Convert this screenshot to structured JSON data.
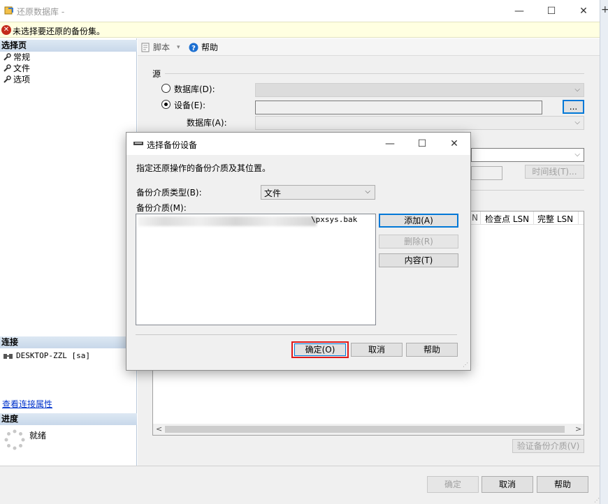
{
  "window": {
    "title": "还原数据库 -",
    "minimize": "—",
    "maximize": "☐",
    "close": "✕"
  },
  "error": {
    "icon": "error-icon",
    "text": "未选择要还原的备份集。"
  },
  "left": {
    "select_page": "选择页",
    "pages": [
      "常规",
      "文件",
      "选项"
    ],
    "connection_header": "连接",
    "server": "DESKTOP-ZZL [sa]",
    "view_props": "查看连接属性",
    "progress_header": "进度",
    "status": "就绪"
  },
  "toolbar": {
    "script": "脚本",
    "help": "帮助"
  },
  "source": {
    "group": "源",
    "database_label": "数据库(D):",
    "device_label": "设备(E):",
    "browse": "...",
    "db_label": "数据库(A):"
  },
  "main": {
    "timeline": "时间线(T)...",
    "grid_headers": [
      "检查点 LSN",
      "完整 LSN"
    ],
    "verify": "验证备份介质(V)",
    "ok": "确定",
    "cancel": "取消",
    "help": "帮助"
  },
  "dialog": {
    "title": "选择备份设备",
    "description": "指定还原操作的备份介质及其位置。",
    "media_type_label": "备份介质类型(B):",
    "media_type_value": "文件",
    "media_label": "备份介质(M):",
    "media_items": [
      "\\pxsys.bak"
    ],
    "add": "添加(A)",
    "remove": "删除(R)",
    "contents": "内容(T)",
    "ok": "确定(O)",
    "cancel": "取消",
    "help": "帮助"
  },
  "colors": {
    "accent": "#0078d7",
    "highlight_box": "#e01a1a",
    "error": "#c42b1c"
  }
}
